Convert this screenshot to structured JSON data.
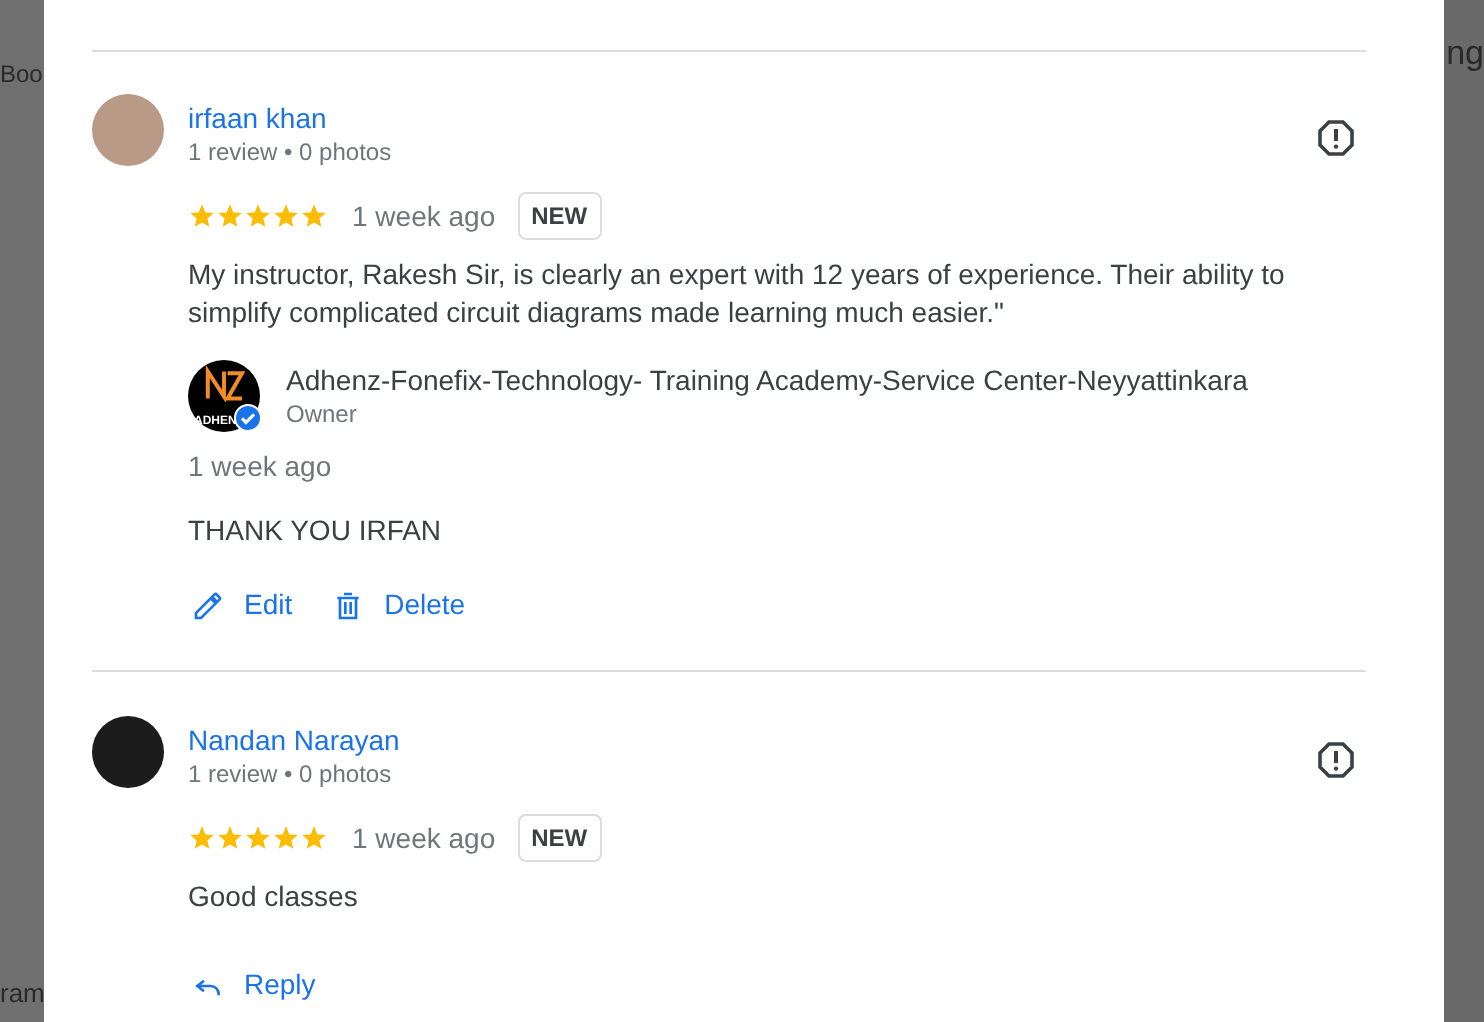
{
  "background": {
    "texts": [
      "Boo",
      "ng",
      "ram"
    ]
  },
  "reviews": [
    {
      "author": "irfaan khan",
      "meta": "1 review • 0 photos",
      "stars": 5,
      "time": "1 week ago",
      "badge": "NEW",
      "text": "My instructor, Rakesh Sir, is clearly an expert with 12 years of experience. Their ability to simplify complicated circuit diagrams made learning much easier.\"",
      "owner_reply": {
        "name": "Adhenz-Fonefix-Technology- Training Academy-Service Center-Neyyattinkara",
        "role": "Owner",
        "logo_text": "ADHEN",
        "verified": true,
        "time": "1 week ago",
        "text": "THANK YOU IRFAN"
      },
      "actions": [
        {
          "kind": "edit",
          "label": "Edit"
        },
        {
          "kind": "delete",
          "label": "Delete"
        }
      ]
    },
    {
      "author": "Nandan Narayan",
      "meta": "1 review • 0 photos",
      "stars": 5,
      "time": "1 week ago",
      "badge": "NEW",
      "text": "Good classes",
      "actions": [
        {
          "kind": "reply",
          "label": "Reply"
        }
      ]
    }
  ]
}
